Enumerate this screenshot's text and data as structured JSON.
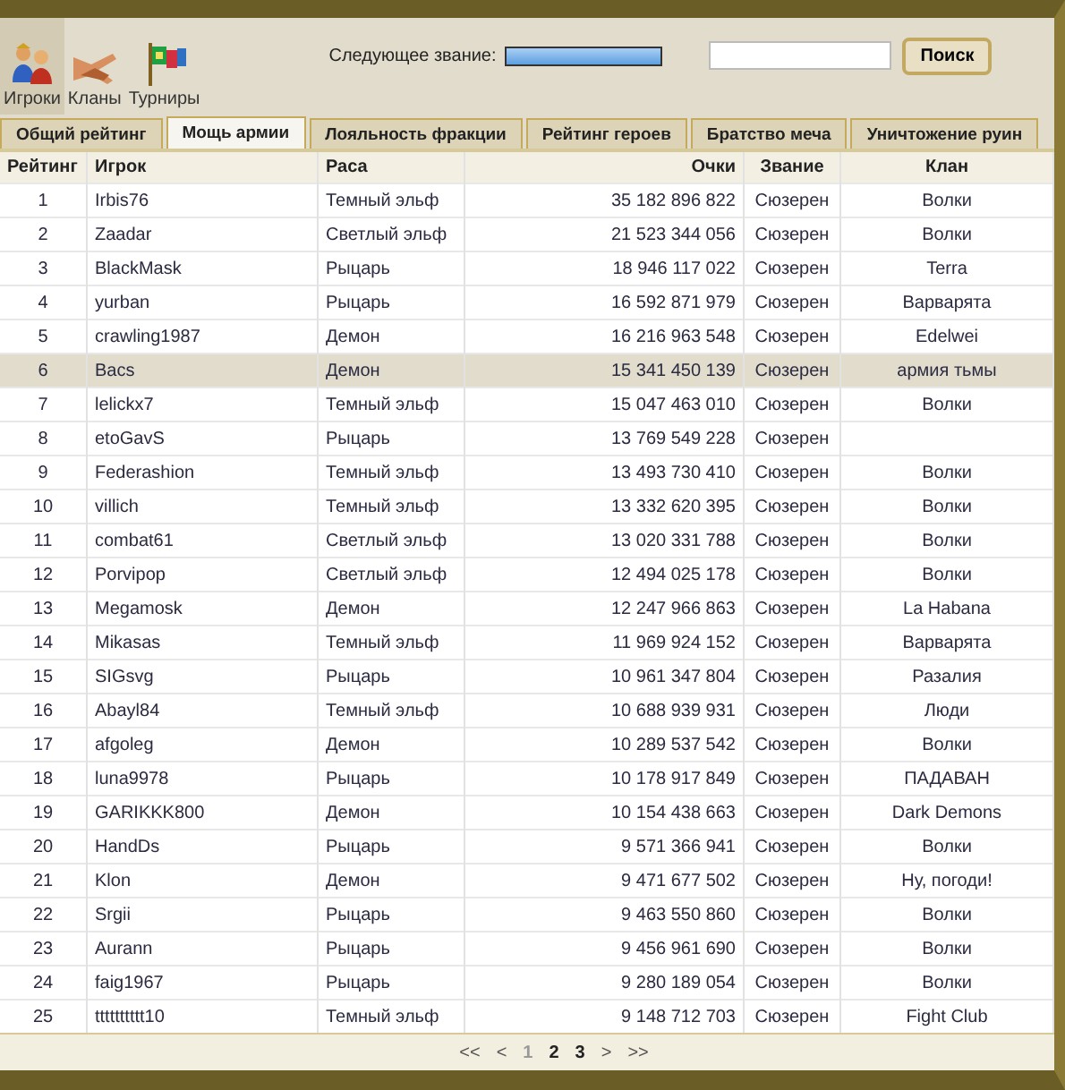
{
  "nav": [
    {
      "label": "Игроки",
      "selected": true
    },
    {
      "label": "Кланы",
      "selected": false
    },
    {
      "label": "Турниры",
      "selected": false
    }
  ],
  "next_rank": {
    "label": "Следующее звание:",
    "level": 1
  },
  "search": {
    "button": "Поиск"
  },
  "tabs": [
    {
      "label": "Общий рейтинг",
      "selected": false
    },
    {
      "label": "Мощь армии",
      "selected": true
    },
    {
      "label": "Лояльность фракции",
      "selected": false
    },
    {
      "label": "Рейтинг героев",
      "selected": false
    },
    {
      "label": "Братство меча",
      "selected": false
    },
    {
      "label": "Уничтожение руин",
      "selected": false
    }
  ],
  "table": {
    "columns": [
      "Рейтинг",
      "Игрок",
      "Раса",
      "Очки",
      "Звание",
      "Клан"
    ],
    "rows": [
      {
        "rank": "1",
        "player": "Irbis76",
        "race": "Темный эльф",
        "points": "35 182 896 822",
        "title": "Сюзерен",
        "clan": "Волки",
        "selected": false
      },
      {
        "rank": "2",
        "player": "Zaadar",
        "race": "Светлый эльф",
        "points": "21 523 344 056",
        "title": "Сюзерен",
        "clan": "Волки",
        "selected": false
      },
      {
        "rank": "3",
        "player": "BlackMask",
        "race": "Рыцарь",
        "points": "18 946 117 022",
        "title": "Сюзерен",
        "clan": "Terra",
        "selected": false
      },
      {
        "rank": "4",
        "player": "yurban",
        "race": "Рыцарь",
        "points": "16 592 871 979",
        "title": "Сюзерен",
        "clan": "Варварята",
        "selected": false
      },
      {
        "rank": "5",
        "player": "crawling1987",
        "race": "Демон",
        "points": "16 216 963 548",
        "title": "Сюзерен",
        "clan": "Edelwei",
        "selected": false
      },
      {
        "rank": "6",
        "player": "Bacs",
        "race": "Демон",
        "points": "15 341 450 139",
        "title": "Сюзерен",
        "clan": "армия тьмы",
        "selected": true
      },
      {
        "rank": "7",
        "player": "lelickx7",
        "race": "Темный эльф",
        "points": "15 047 463 010",
        "title": "Сюзерен",
        "clan": "Волки",
        "selected": false
      },
      {
        "rank": "8",
        "player": "etoGavS",
        "race": "Рыцарь",
        "points": "13 769 549 228",
        "title": "Сюзерен",
        "selected": false
      },
      {
        "rank": "9",
        "player": "Federashion",
        "race": "Темный эльф",
        "points": "13 493 730 410",
        "title": "Сюзерен",
        "clan": "Волки",
        "selected": false
      },
      {
        "rank": "10",
        "player": "villich",
        "race": "Темный эльф",
        "points": "13 332 620 395",
        "title": "Сюзерен",
        "clan": "Волки",
        "selected": false
      },
      {
        "rank": "11",
        "player": "combat61",
        "race": "Светлый эльф",
        "points": "13 020 331 788",
        "title": "Сюзерен",
        "clan": "Волки",
        "selected": false
      },
      {
        "rank": "12",
        "player": "Porvipop",
        "race": "Светлый эльф",
        "points": "12 494 025 178",
        "title": "Сюзерен",
        "clan": "Волки",
        "selected": false
      },
      {
        "rank": "13",
        "player": "Megamosk",
        "race": "Демон",
        "points": "12 247 966 863",
        "title": "Сюзерен",
        "clan": "La Habana",
        "selected": false
      },
      {
        "rank": "14",
        "player": "Mikasas",
        "race": "Темный эльф",
        "points": "11 969 924 152",
        "title": "Сюзерен",
        "clan": "Варварята",
        "selected": false
      },
      {
        "rank": "15",
        "player": "SIGsvg",
        "race": "Рыцарь",
        "points": "10 961 347 804",
        "title": "Сюзерен",
        "clan": "Разалия",
        "selected": false
      },
      {
        "rank": "16",
        "player": "Abayl84",
        "race": "Темный эльф",
        "points": "10 688 939 931",
        "title": "Сюзерен",
        "clan": "Люди",
        "selected": false
      },
      {
        "rank": "17",
        "player": "afgoleg",
        "race": "Демон",
        "points": "10 289 537 542",
        "title": "Сюзерен",
        "clan": "Волки",
        "selected": false
      },
      {
        "rank": "18",
        "player": "luna9978",
        "race": "Рыцарь",
        "points": "10 178 917 849",
        "title": "Сюзерен",
        "clan": "ПАДАВАН",
        "selected": false
      },
      {
        "rank": "19",
        "player": "GARIKKK800",
        "race": "Демон",
        "points": "10 154 438 663",
        "title": "Сюзерен",
        "clan": "Dark Demons",
        "selected": false
      },
      {
        "rank": "20",
        "player": "HandDs",
        "race": "Рыцарь",
        "points": "9 571 366 941",
        "title": "Сюзерен",
        "clan": "Волки",
        "selected": false
      },
      {
        "rank": "21",
        "player": "Klon",
        "race": "Демон",
        "points": "9 471 677 502",
        "title": "Сюзерен",
        "clan": "Ну, погоди!",
        "selected": false
      },
      {
        "rank": "22",
        "player": "Srgii",
        "race": "Рыцарь",
        "points": "9 463 550 860",
        "title": "Сюзерен",
        "clan": "Волки",
        "selected": false
      },
      {
        "rank": "23",
        "player": "Aurann",
        "race": "Рыцарь",
        "points": "9 456 961 690",
        "title": "Сюзерен",
        "clan": "Волки",
        "selected": false
      },
      {
        "rank": "24",
        "player": "faig1967",
        "race": "Рыцарь",
        "points": "9 280 189 054",
        "title": "Сюзерен",
        "clan": "Волки",
        "selected": false
      },
      {
        "rank": "25",
        "player": "tttttttttt10",
        "race": "Темный эльф",
        "points": "9 148 712 703",
        "title": "Сюзерен",
        "clan": "Fight Club",
        "selected": false
      }
    ]
  },
  "pager": {
    "first": "<<",
    "prev": "<",
    "pages": [
      {
        "label": "1",
        "selected": true
      },
      {
        "label": "2",
        "selected": false
      },
      {
        "label": "3",
        "selected": false
      }
    ],
    "next": ">",
    "last": ">>"
  }
}
